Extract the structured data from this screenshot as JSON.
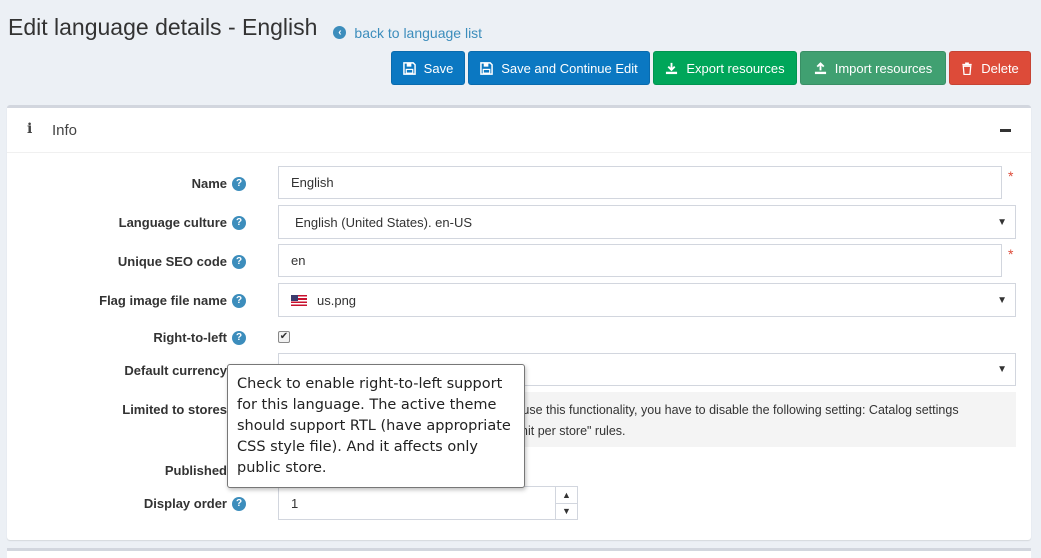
{
  "header": {
    "title": "Edit language details - English",
    "back_link": "back to language list"
  },
  "toolbar": {
    "save": "Save",
    "save_continue": "Save and Continue Edit",
    "export": "Export resources",
    "import": "Import resources",
    "delete": "Delete"
  },
  "panel": {
    "title": "Info"
  },
  "form": {
    "name": {
      "label": "Name",
      "value": "English",
      "required": "*"
    },
    "culture": {
      "label": "Language culture",
      "value": "English (United States). en-US"
    },
    "seo": {
      "label": "Unique SEO code",
      "value": "en",
      "required": "*"
    },
    "flag": {
      "label": "Flag image file name",
      "value": "us.png"
    },
    "rtl": {
      "label": "Right-to-left",
      "checked": true
    },
    "currency": {
      "label": "Default currency",
      "value": ""
    },
    "stores": {
      "label": "Limited to stores",
      "notice_line1": "o use this functionality, you have to disable the following setting: Catalog settings",
      "notice_line2": "limit per store\" rules."
    },
    "published": {
      "label": "Published"
    },
    "display_order": {
      "label": "Display order",
      "value": "1"
    }
  },
  "tooltip": {
    "text": "Check to enable right-to-left support for this language. The active theme should support RTL (have appropriate CSS style file). And it affects only public store."
  },
  "colors": {
    "primary": "#0b78c2",
    "success": "#00a65a",
    "import": "#40a071",
    "danger": "#dd4b39",
    "link": "#3c8dbc"
  }
}
